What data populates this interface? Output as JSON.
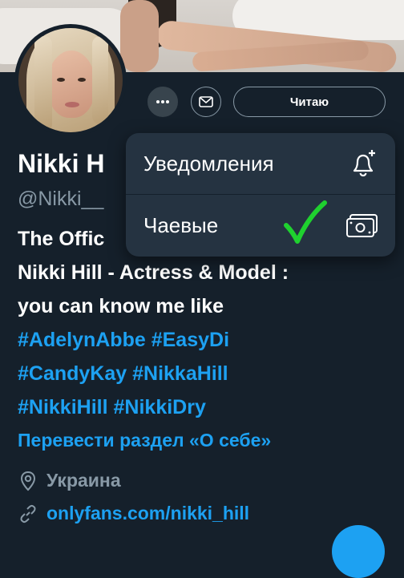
{
  "profile": {
    "name": "Nikki H",
    "handle": "@Nikki__",
    "bio_line1": "The Offic",
    "bio_line2": "Nikki Hill - Actress & Model :",
    "bio_line3": "you can know me like",
    "hashtags_line4": [
      "#AdelynAbbe",
      "#EasyDi"
    ],
    "hashtags_line5": [
      "#CandyKay",
      "#NikkaHill"
    ],
    "hashtags_line6": [
      "#NikkiHill",
      "#NikkiDry"
    ],
    "translate_label": "Перевести раздел «О себе»",
    "location": "Украина",
    "link": "onlyfans.com/nikki_hill"
  },
  "actions": {
    "more_icon": "more-horizontal-icon",
    "mail_icon": "mail-icon",
    "follow_label": "Читаю"
  },
  "dropdown": {
    "items": [
      {
        "label": "Уведомления",
        "icon": "bell-plus-icon"
      },
      {
        "label": "Чаевые",
        "icon": "money-icon",
        "annotation": "green-checkmark"
      }
    ]
  },
  "colors": {
    "background": "#15202b",
    "accent": "#1da1f2",
    "muted": "#8899a6",
    "menu_bg": "#253341",
    "check": "#1fd12f"
  }
}
